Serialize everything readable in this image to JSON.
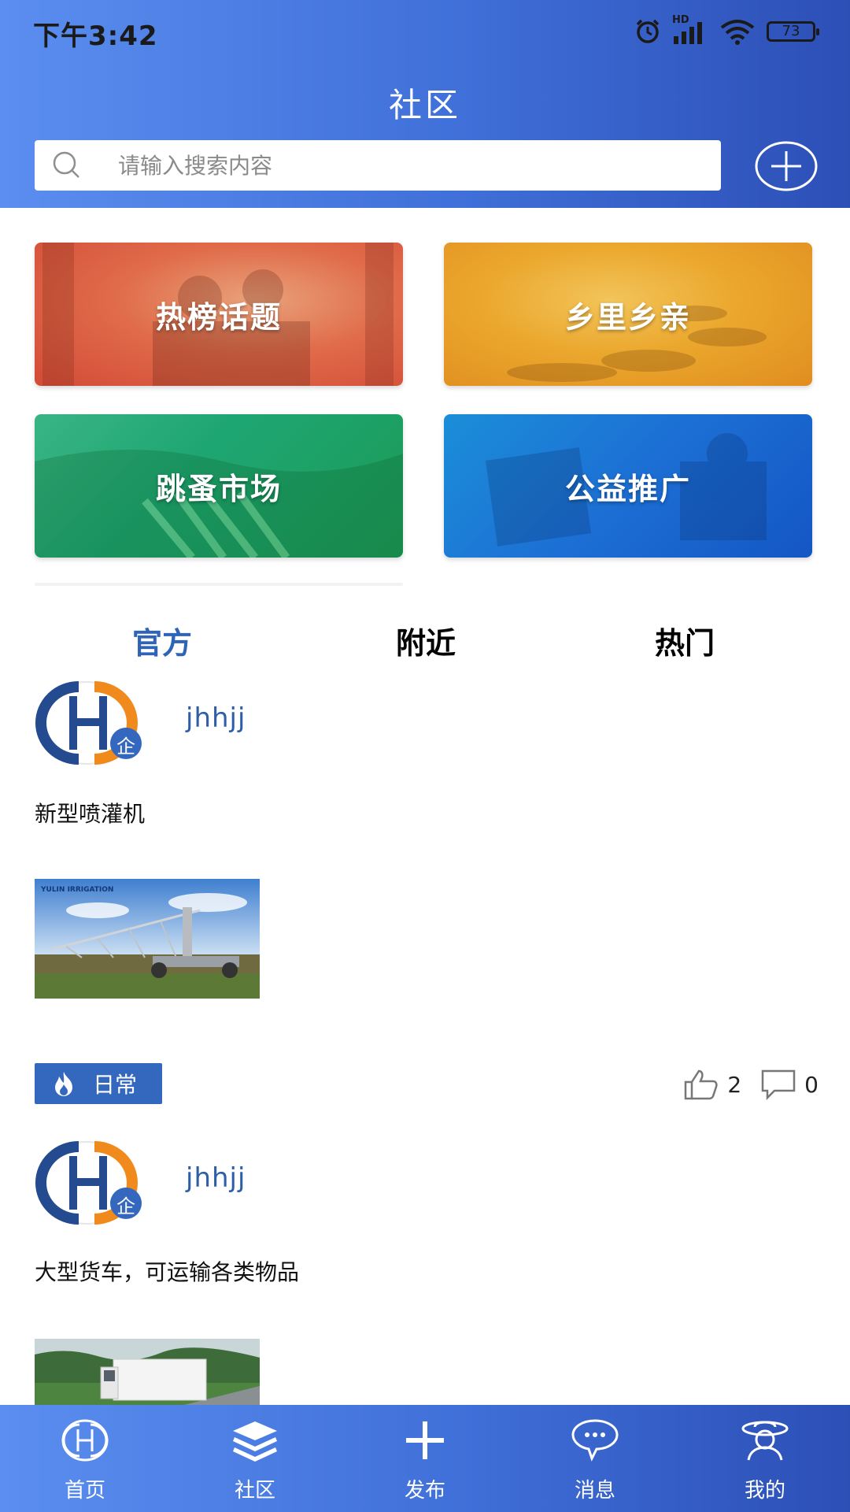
{
  "status_bar": {
    "time": "下午3:42",
    "battery": "73",
    "network": "HD"
  },
  "header": {
    "title": "社区",
    "search_placeholder": "请输入搜索内容"
  },
  "categories": [
    {
      "label": "热榜话题"
    },
    {
      "label": "乡里乡亲"
    },
    {
      "label": "跳蚤市场"
    },
    {
      "label": "公益推广"
    }
  ],
  "tabs": [
    {
      "label": "官方",
      "active": true
    },
    {
      "label": "附近",
      "active": false
    },
    {
      "label": "热门",
      "active": false
    }
  ],
  "posts": [
    {
      "username": "jhhjj",
      "badge": "企",
      "text": "新型喷灌机",
      "image_caption": "YULIN IRRIGATION",
      "tag": "日常",
      "likes": "2",
      "comments": "0"
    },
    {
      "username": "jhhjj",
      "badge": "企",
      "text": "大型货车，可运输各类物品"
    }
  ],
  "bottom_nav": [
    {
      "label": "首页",
      "icon": "home-logo-icon"
    },
    {
      "label": "社区",
      "icon": "layers-icon"
    },
    {
      "label": "发布",
      "icon": "plus-icon"
    },
    {
      "label": "消息",
      "icon": "message-icon"
    },
    {
      "label": "我的",
      "icon": "profile-icon"
    }
  ],
  "colors": {
    "accent": "#3467be",
    "header_start": "#5b8ef0",
    "header_end": "#2c4fb6",
    "username": "#2f5ea8"
  }
}
